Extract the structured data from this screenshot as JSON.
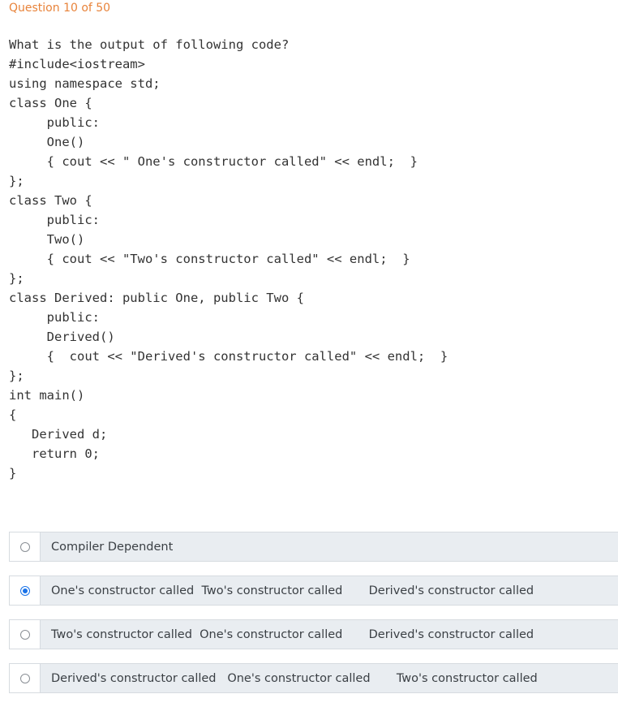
{
  "question": {
    "header": "Question 10 of 50",
    "code_lines": [
      "What is the output of following code?",
      "#include<iostream>",
      "using namespace std;",
      "class One {",
      "     public:",
      "     One()",
      "     { cout << \" One's constructor called\" << endl;  }",
      "};",
      "class Two {",
      "     public:",
      "     Two()",
      "     { cout << \"Two's constructor called\" << endl;  }",
      "};",
      "class Derived: public One, public Two {",
      "     public:",
      "     Derived()",
      "     {  cout << \"Derived's constructor called\" << endl;  }",
      "};",
      "int main()",
      "{",
      "   Derived d;",
      "   return 0;",
      "}"
    ]
  },
  "options": [
    {
      "label": "Compiler Dependent",
      "selected": false
    },
    {
      "label": "One's constructor called  Two's constructor called       Derived's constructor called",
      "selected": true
    },
    {
      "label": "Two's constructor called  One's constructor called       Derived's constructor called",
      "selected": false
    },
    {
      "label": "Derived's constructor called   One's constructor called       Two's constructor called",
      "selected": false
    }
  ],
  "colors": {
    "header": "#e8833a",
    "radio_selected": "#1a73e8",
    "option_background": "#e9edf1"
  }
}
